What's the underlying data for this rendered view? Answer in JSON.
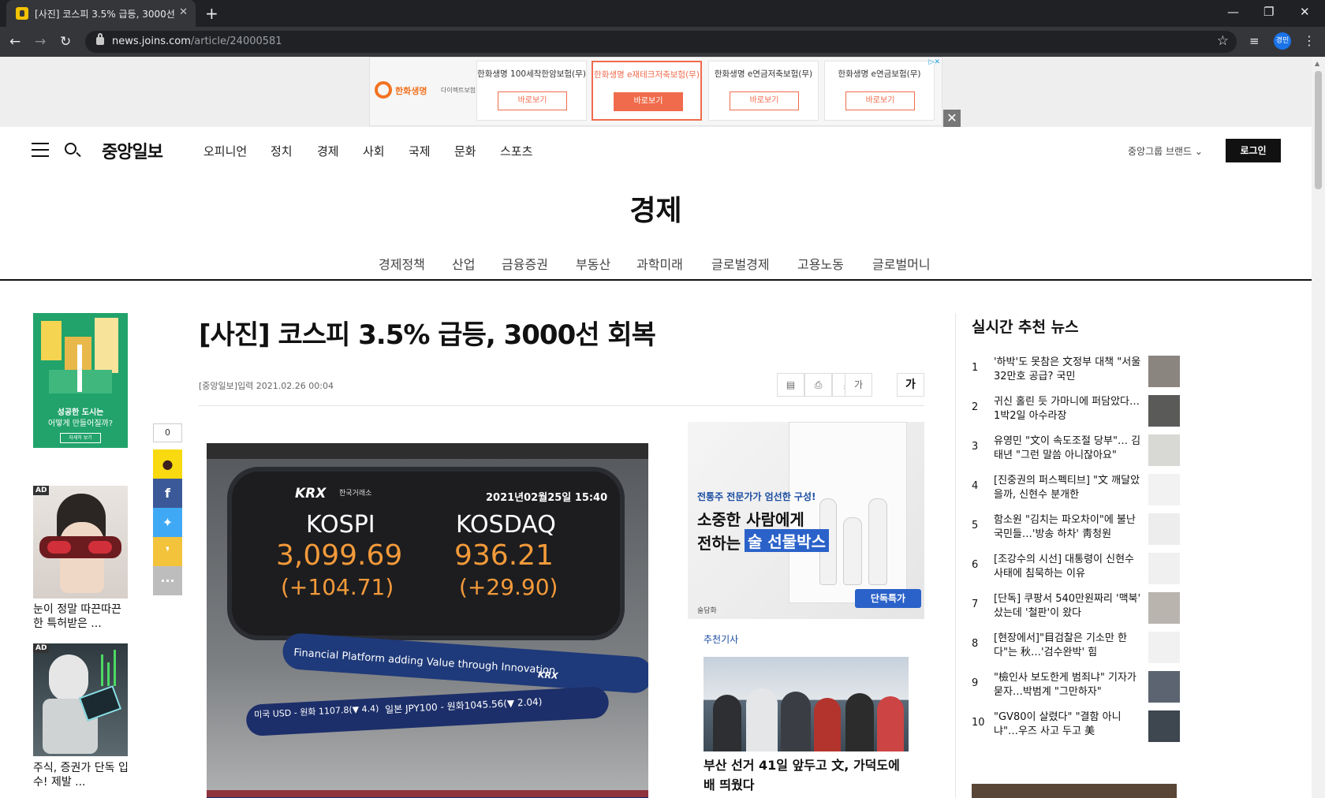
{
  "browser": {
    "tab_title": "[사진] 코스피 3.5% 급등, 3000선",
    "url_host": "news.joins.com",
    "url_path": "/article/24000581",
    "profile_label": "경민"
  },
  "top_ad": {
    "brand": "한화생명",
    "brand_sub": "다이렉트보험",
    "cards": [
      {
        "title": "한화생명 100세착한암보험(무)",
        "button": "바로보기"
      },
      {
        "title": "한화생명 e재테크저축보험(무)",
        "button": "바로보기"
      },
      {
        "title": "한화생명 e연금저축보험(무)",
        "button": "바로보기"
      },
      {
        "title": "한화생명 e연금보험(무)",
        "button": "바로보기"
      }
    ],
    "close": "✕"
  },
  "header": {
    "logo": "중앙일보",
    "nav": [
      "오피니언",
      "정치",
      "경제",
      "사회",
      "국제",
      "문화",
      "스포츠"
    ],
    "group_brand": "중앙그룹 브랜드 ⌄",
    "login": "로그인"
  },
  "section": {
    "title": "경제",
    "subnav": [
      "경제정책",
      "산업",
      "금융증권",
      "부동산",
      "과학미래",
      "글로벌경제",
      "고용노동",
      "글로벌머니"
    ]
  },
  "left_ads": {
    "city_line1": "성공한 도시는",
    "city_line2": "어떻게 만들어질까?",
    "city_button": "자세히 보기",
    "ad_tag": "AD",
    "ad1_caption": "눈이 정말 따끈따끈한 특허받은 ...",
    "ad2_caption": "주식, 증권가 단독 입수! 제발 ..."
  },
  "share": {
    "count": "0",
    "buttons": [
      "kakao",
      "facebook",
      "twitter",
      "naver",
      "more"
    ],
    "more_label": "···"
  },
  "article": {
    "title": "[사진] 코스피 3.5% 급등, 3000선 회복",
    "byline": "[중앙일보]입력 2021.02.26 00:04",
    "font_small": "가",
    "font_large": "가",
    "photo": {
      "board_logo": "KRX",
      "board_logo_sub": "한국거래소",
      "board_date": "2021년02월25일 15:40",
      "kospi_label": "KOSPI",
      "kospi_value": "3,099.69",
      "kospi_change": "(+104.71)",
      "kosdaq_label": "KOSDAQ",
      "kosdaq_value": "936.21",
      "kosdaq_change": "(+29.90)",
      "ring_text": "Financial Platform adding Value through Innovation",
      "ring_krx": "KRX",
      "usd_text": "미국 USD - 원화 1107.8(▼ 4.4)",
      "jpy_text": "일본 JPY100 - 원화1045.56(▼ 2.04)"
    }
  },
  "middle_ad": {
    "kicker": "전통주 전문가가 엄선한 구성!",
    "line1": "소중한 사람에게",
    "line2a": "전하는",
    "line2b": "술 선물박스",
    "deal": "단독특가",
    "brand": "술담화"
  },
  "recommended": {
    "label": "추천기사",
    "title": "부산 선거 41일 앞두고 文, 가덕도에 배 띄웠다"
  },
  "trending": {
    "title": "실시간 추천 뉴스",
    "items": [
      {
        "rank": "1",
        "text": "'하박'도 못참은 文정부 대책 \"서울 32만호 공급? 국민"
      },
      {
        "rank": "2",
        "text": "귀신 홀린 듯 가마니에 퍼담았다…1박2일 아수라장"
      },
      {
        "rank": "3",
        "text": "유영민 \"文이 속도조절 당부\"… 김태년 \"그런 말씀 아니잖아요\""
      },
      {
        "rank": "4",
        "text": "[진중권의 퍼스펙티브] \"文 깨달았을까, 신현수 분개한"
      },
      {
        "rank": "5",
        "text": "함소원 \"김치는 파오차이\"에 불난 국민들…'방송 하차' 靑청원"
      },
      {
        "rank": "6",
        "text": "[조강수의 시선] 대통령이 신현수 사태에 침묵하는 이유"
      },
      {
        "rank": "7",
        "text": "[단독] 쿠팡서 540만원짜리 '맥북' 샀는데 '철판'이 왔다"
      },
      {
        "rank": "8",
        "text": "[현장에서]\"目검찰은 기소만 한다\"는 秋…'검수완박' 힘"
      },
      {
        "rank": "9",
        "text": "\"檢인사 보도한게 범죄냐\" 기자가 묻자…박범계 \"그만하자\""
      },
      {
        "rank": "10",
        "text": "\"GV80이 살렸다\" \"결함 아니냐\"…우즈 사고 두고 美"
      }
    ]
  }
}
